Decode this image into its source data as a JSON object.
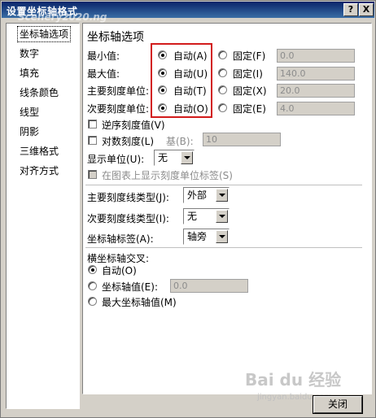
{
  "window": {
    "title": "设置坐标轴格式",
    "help_button": "?",
    "close_button": "X"
  },
  "title_watermark": "Scenery2020.ng",
  "sidebar": {
    "items": [
      {
        "label": "坐标轴选项",
        "selected": true
      },
      {
        "label": "数字"
      },
      {
        "label": "填充"
      },
      {
        "label": "线条颜色"
      },
      {
        "label": "线型"
      },
      {
        "label": "阴影"
      },
      {
        "label": "三维格式"
      },
      {
        "label": "对齐方式"
      }
    ]
  },
  "panel": {
    "heading": "坐标轴选项",
    "rows": [
      {
        "label": "最小值:",
        "auto": "自动(A)",
        "fixed": "固定(F)",
        "value": "0.0"
      },
      {
        "label": "最大值:",
        "auto": "自动(U)",
        "fixed": "固定(I)",
        "value": "140.0"
      },
      {
        "label": "主要刻度单位:",
        "auto": "自动(T)",
        "fixed": "固定(X)",
        "value": "20.0"
      },
      {
        "label": "次要刻度单位:",
        "auto": "自动(O)",
        "fixed": "固定(E)",
        "value": "4.0"
      }
    ],
    "reverse_order": "逆序刻度值(V)",
    "log_scale": "对数刻度(L)",
    "log_base_label": "基(B):",
    "log_base_value": "10",
    "display_units_label": "显示单位(U):",
    "display_units_value": "无",
    "show_units_label": "在图表上显示刻度单位标签(S)",
    "major_tick_label": "主要刻度线类型(J):",
    "major_tick_value": "外部",
    "minor_tick_label": "次要刻度线类型(I):",
    "minor_tick_value": "无",
    "axis_labels_label": "坐标轴标签(A):",
    "axis_labels_value": "轴旁",
    "cross_heading": "横坐标轴交叉:",
    "cross_auto": "自动(O)",
    "cross_value_label": "坐标轴值(E):",
    "cross_value": "0.0",
    "cross_max": "最大坐标轴值(M)"
  },
  "footer": {
    "close_label": "关闭"
  },
  "watermark": {
    "brand": "Bai du 经验",
    "url": "jingyan.baidu.com"
  }
}
